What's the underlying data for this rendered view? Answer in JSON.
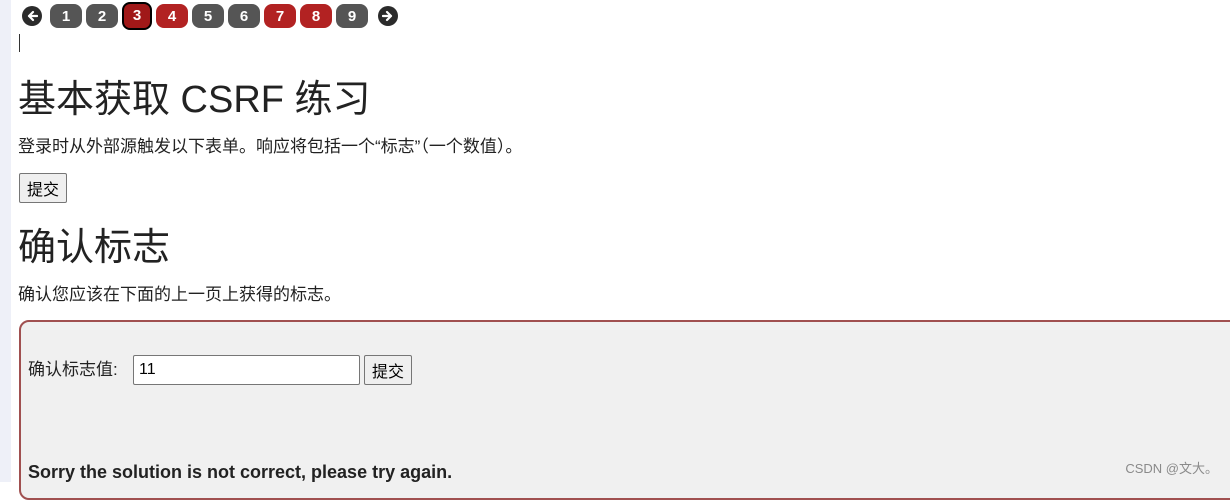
{
  "pagination": {
    "prev_icon": "arrow-left-icon",
    "next_icon": "arrow-right-icon",
    "pages": [
      {
        "label": "1",
        "state": "unsolved"
      },
      {
        "label": "2",
        "state": "unsolved"
      },
      {
        "label": "3",
        "state": "current"
      },
      {
        "label": "4",
        "state": "solved"
      },
      {
        "label": "5",
        "state": "unsolved"
      },
      {
        "label": "6",
        "state": "unsolved"
      },
      {
        "label": "7",
        "state": "solved"
      },
      {
        "label": "8",
        "state": "solved"
      },
      {
        "label": "9",
        "state": "unsolved"
      }
    ]
  },
  "section1": {
    "title": "基本获取 CSRF 练习",
    "description": "登录时从外部源触发以下表单。响应将包括一个“标志”（一个数值）。",
    "submit_label": "提交"
  },
  "section2": {
    "title": "确认标志",
    "description": "确认您应该在下面的上一页上获得的标志。",
    "flag_label": "确认标志值:",
    "flag_value": "11",
    "submit_label": "提交",
    "feedback": "Sorry the solution is not correct, please try again."
  },
  "watermark": "CSDN @文大。",
  "colors": {
    "unsolved": "#555555",
    "solved": "#b22222",
    "current": "#a01818",
    "box_border": "#a05050"
  }
}
